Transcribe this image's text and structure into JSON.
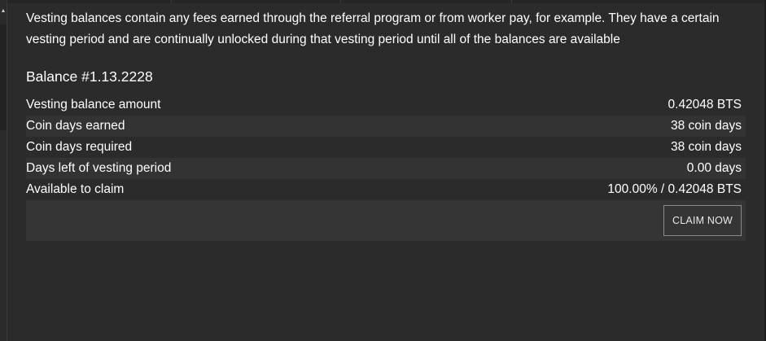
{
  "intro_text": "Vesting balances contain any fees earned through the referral program or from worker pay, for example. They have a certain vesting period and are continually unlocked during that vesting period until all of the balances are available",
  "balance": {
    "title": "Balance #1.13.2228",
    "rows": [
      {
        "label": "Vesting balance amount",
        "value": "0.42048 BTS"
      },
      {
        "label": "Coin days earned",
        "value": "38 coin days"
      },
      {
        "label": "Coin days required",
        "value": "38 coin days"
      },
      {
        "label": "Days left of vesting period",
        "value": "0.00 days"
      },
      {
        "label": "Available to claim",
        "value": "100.00% / 0.42048 BTS"
      }
    ],
    "claim_button_label": "CLAIM NOW"
  },
  "icons": {
    "scroll_up": "chevron-up-icon"
  }
}
